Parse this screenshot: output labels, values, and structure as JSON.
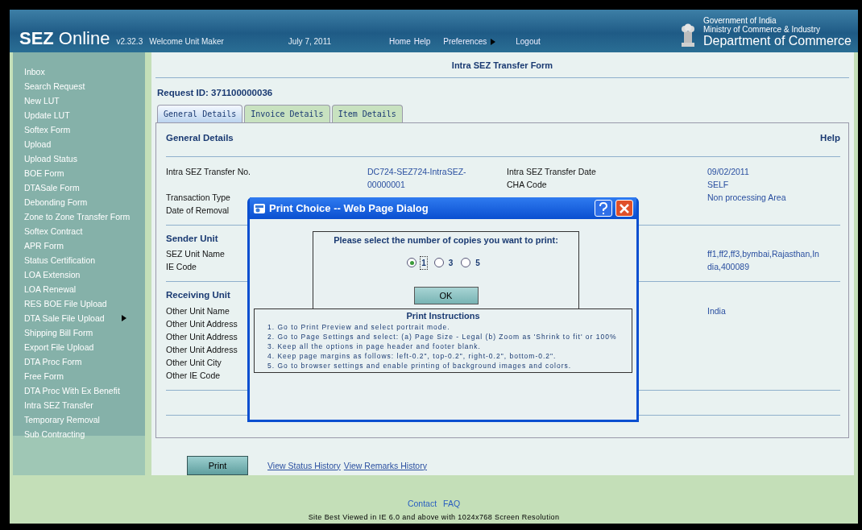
{
  "header": {
    "logo_bold": "SEZ",
    "logo_rest": "Online",
    "version": "v2.32.3",
    "welcome": "Welcome Unit Maker",
    "date": "July 7, 2011",
    "nav": [
      {
        "label": "Home",
        "has_submenu": false
      },
      {
        "label": "Help",
        "has_submenu": false
      },
      {
        "label": "Preferences",
        "has_submenu": true
      },
      {
        "label": "Logout",
        "has_submenu": false
      }
    ],
    "org_lines": [
      "Government of India",
      "Ministry of Commerce & Industry"
    ],
    "department": "Department of Commerce"
  },
  "sidebar": {
    "items": [
      {
        "label": "Inbox",
        "has_submenu": false
      },
      {
        "label": "Search Request",
        "has_submenu": false
      },
      {
        "label": "New LUT",
        "has_submenu": false
      },
      {
        "label": "Update LUT",
        "has_submenu": false
      },
      {
        "label": "Softex Form",
        "has_submenu": false
      },
      {
        "label": "Upload",
        "has_submenu": false
      },
      {
        "label": "Upload Status",
        "has_submenu": false
      },
      {
        "label": "BOE Form",
        "has_submenu": false
      },
      {
        "label": "DTASale Form",
        "has_submenu": false
      },
      {
        "label": "Debonding Form",
        "has_submenu": false
      },
      {
        "label": "Zone to Zone Transfer Form",
        "has_submenu": false
      },
      {
        "label": "Softex Contract",
        "has_submenu": false
      },
      {
        "label": "APR Form",
        "has_submenu": false
      },
      {
        "label": "Status Certification",
        "has_submenu": false
      },
      {
        "label": "LOA Extension",
        "has_submenu": false
      },
      {
        "label": "LOA Renewal",
        "has_submenu": false
      },
      {
        "label": "RES BOE File Upload",
        "has_submenu": false
      },
      {
        "label": "DTA Sale File Upload",
        "has_submenu": true
      },
      {
        "label": "Shipping Bill Form",
        "has_submenu": false
      },
      {
        "label": "Export File Upload",
        "has_submenu": false
      },
      {
        "label": "DTA Proc Form",
        "has_submenu": false
      },
      {
        "label": "Free Form",
        "has_submenu": false
      },
      {
        "label": "DTA Proc With Ex Benefit",
        "has_submenu": false
      },
      {
        "label": "Intra SEZ Transfer",
        "has_submenu": false
      },
      {
        "label": "Temporary Removal",
        "has_submenu": false
      },
      {
        "label": "Sub Contracting",
        "has_submenu": false
      }
    ]
  },
  "page_title": "Intra SEZ Transfer Form",
  "request_id": "Request ID: 371100000036",
  "tabs": [
    {
      "label": "General Details",
      "selected": true
    },
    {
      "label": "Invoice Details",
      "selected": false
    },
    {
      "label": "Item Details",
      "selected": false
    }
  ],
  "panel": {
    "title": "General Details",
    "help": "Help",
    "sections": [
      {
        "rows": [
          {
            "label": "Intra SEZ Transfer No.",
            "value": "DC724-SEZ724-IntraSEZ-00000001",
            "label_2": "Intra SEZ Transfer Date",
            "value_2": "09/02/2011"
          },
          {
            "label_2": "CHA Code",
            "value_2": "SELF"
          },
          {
            "label": "Transaction Type",
            "value_2": "Non processing Area"
          },
          {
            "label": "Date of Removal"
          }
        ]
      },
      {
        "heading": "Sender Unit",
        "rows": [
          {
            "label": "SEZ Unit Name",
            "value_2": "ff1,ff2,ff3,bymbai,Rajasthan,India,400089"
          },
          {
            "label": "IE Code"
          }
        ]
      },
      {
        "heading": "Receiving Unit",
        "rows": [
          {
            "label": "Other Unit Name",
            "value_2": "India"
          },
          {
            "label": "Other Unit Address"
          },
          {
            "label": "Other Unit Address"
          },
          {
            "label": "Other Unit Address"
          },
          {
            "label": "Other Unit City"
          },
          {
            "label": "Other IE Code"
          }
        ]
      }
    ]
  },
  "actions": {
    "print": "Print",
    "links": [
      "View Status History",
      "View Remarks History"
    ]
  },
  "footer": {
    "links": [
      "Contact",
      "FAQ"
    ],
    "note": "Site Best Viewed in IE 6.0 and above with 1024x768 Screen Resolution"
  },
  "dialog": {
    "title": "Print Choice -- Web Page Dialog",
    "prompt": "Please select the number of copies you want to print:",
    "copies": [
      {
        "label": "1",
        "selected": true
      },
      {
        "label": "3",
        "selected": false
      },
      {
        "label": "5",
        "selected": false
      }
    ],
    "ok": "OK",
    "instructions_title": "Print Instructions",
    "instructions": [
      "1. Go to Print Preview and select portrait mode.",
      "2. Go to Page Settings and select: (a) Page Size - Legal (b) Zoom as 'Shrink to fit' or 100%",
      "3. Keep all the options in page header and footer blank.",
      "4. Keep page margins as follows: left-0.2\", top-0.2\", right-0.2\", bottom-0.2\".",
      "5. Go to browser settings and enable printing of background images and colors."
    ]
  }
}
